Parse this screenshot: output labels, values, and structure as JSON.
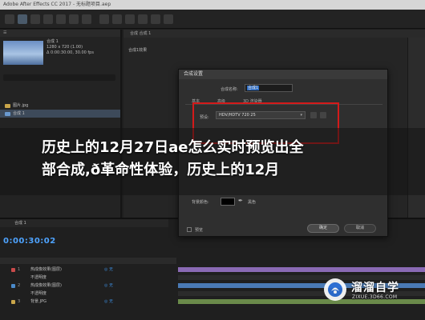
{
  "window": {
    "title": "Adobe After Effects CC 2017 - 无标题项目.aep"
  },
  "project": {
    "comp_name": "合成 1",
    "comp_size": "1280 x 720 (1.00)",
    "comp_duration": "Δ 0:00:30:00, 30.00 fps",
    "items": [
      {
        "name": "图片.jpg",
        "color": "#c9a64a",
        "selected": false
      },
      {
        "name": "合成 1",
        "color": "#6a9ad0",
        "selected": true
      }
    ]
  },
  "viewer": {
    "tab_label": "合成 合成 1",
    "sub_label": "合成1效果"
  },
  "timeline": {
    "tab_label": "合成 1",
    "timecode": "0:00:30:02",
    "layers": [
      {
        "num": "1",
        "name": "热成像效果(图层)",
        "color": "#c94a4a",
        "link": "◎ 无"
      },
      {
        "num": "",
        "name": "不透明度",
        "color": "#555555",
        "link": ""
      },
      {
        "num": "2",
        "name": "热成像效果(图层)",
        "color": "#4a8ac9",
        "link": "◎ 无"
      },
      {
        "num": "",
        "name": "不透明度",
        "color": "#555555",
        "link": ""
      },
      {
        "num": "3",
        "name": "背景.JPG",
        "color": "#c9a64a",
        "link": "◎ 无"
      }
    ],
    "track_colors": [
      "#8a6ab4",
      "#2b2b2b",
      "#4a7ab4",
      "#2b2b2b",
      "#6a8a4a"
    ]
  },
  "dialog": {
    "title": "合成设置",
    "name_label": "合成名称:",
    "name_value": "合成1",
    "tabs": [
      "基本",
      "高级",
      "3D 渲染器"
    ],
    "preset_label": "预设:",
    "preset_value": "HDV/HDTV 720 25",
    "bg_label": "背景颜色:",
    "bg_value": "黑色",
    "preview_label": "预览",
    "ok_label": "确定",
    "cancel_label": "取消"
  },
  "overlay": {
    "line1": "历史上的12月27日ae怎么实时预览出全",
    "line2": "部合成,ð革命性体验，历史上的12月"
  },
  "watermark": {
    "title": "溜溜自学",
    "url": "ZIXUE.3D66.COM"
  },
  "colors": {
    "timecode": "#4ea3ff",
    "highlight_box": "#d41a1a",
    "selection": "#2f6cc0"
  }
}
